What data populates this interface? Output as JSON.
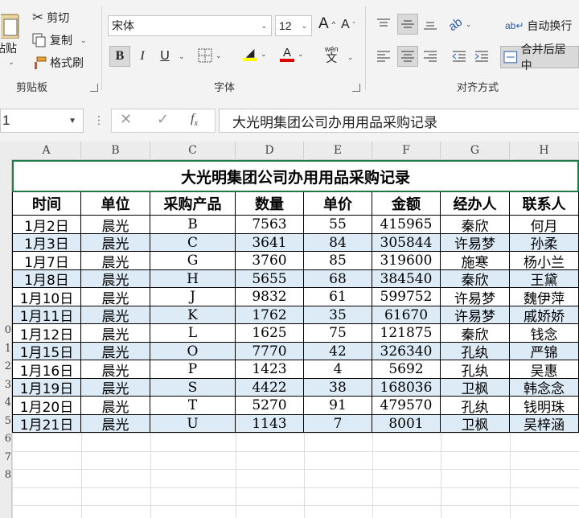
{
  "ribbon": {
    "clipboard": {
      "paste_label": "粘贴",
      "cut_label": "剪切",
      "copy_label": "复制",
      "format_painter_label": "格式刷",
      "group_label": "剪贴板"
    },
    "font": {
      "font_name": "宋体",
      "font_size": "12",
      "grow_label": "A",
      "shrink_label": "A",
      "bold_label": "B",
      "italic_label": "I",
      "underline_label": "U",
      "phonetic_label": "wén",
      "phonetic_char": "文",
      "group_label": "字体",
      "fill_color": "#ffff00",
      "font_color": "#e00000"
    },
    "alignment": {
      "wrap_text_label": "自动换行",
      "merge_center_label": "合并后居中",
      "group_label": "对齐方式"
    }
  },
  "formula_bar": {
    "name_box": "1",
    "formula": "大光明集团公司办用用品采购记录"
  },
  "sheet": {
    "columns": [
      "A",
      "B",
      "C",
      "D",
      "E",
      "F",
      "G",
      "H"
    ],
    "title": "大光明集团公司办用用品采购记录",
    "headers": [
      "时间",
      "单位",
      "采购产品",
      "数量",
      "单价",
      "金额",
      "经办人",
      "联系人"
    ],
    "rows": [
      [
        "1月2日",
        "晨光",
        "B",
        "7563",
        "55",
        "415965",
        "秦欣",
        "何月"
      ],
      [
        "1月3日",
        "晨光",
        "C",
        "3641",
        "84",
        "305844",
        "许易梦",
        "孙柔"
      ],
      [
        "1月7日",
        "晨光",
        "G",
        "3760",
        "85",
        "319600",
        "施寒",
        "杨小兰"
      ],
      [
        "1月8日",
        "晨光",
        "H",
        "5655",
        "68",
        "384540",
        "秦欣",
        "王黛"
      ],
      [
        "1月10日",
        "晨光",
        "J",
        "9832",
        "61",
        "599752",
        "许易梦",
        "魏伊萍"
      ],
      [
        "1月11日",
        "晨光",
        "K",
        "1762",
        "35",
        "61670",
        "许易梦",
        "戚娇娇"
      ],
      [
        "1月12日",
        "晨光",
        "L",
        "1625",
        "75",
        "121875",
        "秦欣",
        "钱念"
      ],
      [
        "1月15日",
        "晨光",
        "O",
        "7770",
        "42",
        "326340",
        "孔纨",
        "严锦"
      ],
      [
        "1月16日",
        "晨光",
        "P",
        "1423",
        "4",
        "5692",
        "孔纨",
        "吴惠"
      ],
      [
        "1月19日",
        "晨光",
        "S",
        "4422",
        "38",
        "168036",
        "卫枫",
        "韩念念"
      ],
      [
        "1月20日",
        "晨光",
        "T",
        "5270",
        "91",
        "479570",
        "孔纨",
        "钱明珠"
      ],
      [
        "1月21日",
        "晨光",
        "U",
        "1143",
        "7",
        "8001",
        "卫枫",
        "吴梓涵"
      ]
    ],
    "row_numbers": [
      "",
      "",
      "",
      "",
      "",
      "",
      "",
      "",
      "0",
      "1",
      "2",
      "3",
      "4",
      "5",
      "6",
      "7",
      "8"
    ],
    "band_color": "#ddebf7",
    "selection_color": "#1d7c45"
  }
}
